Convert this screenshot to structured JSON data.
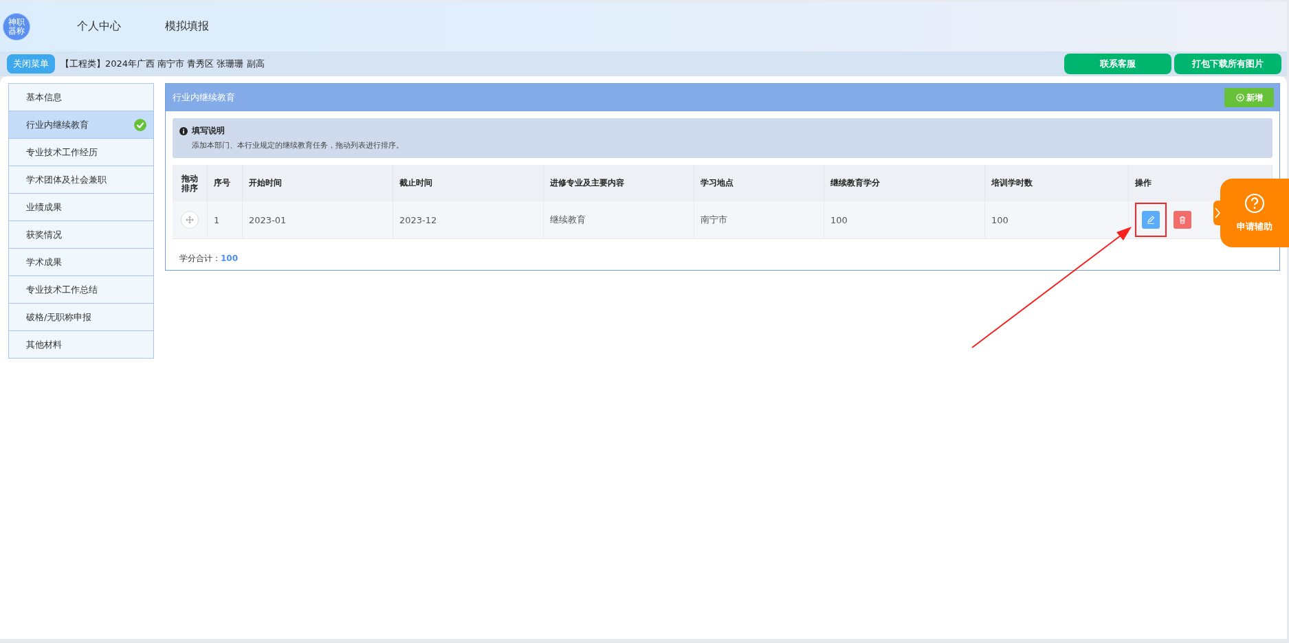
{
  "header": {
    "logo_text": "神职器称",
    "nav": [
      {
        "label": "个人中心"
      },
      {
        "label": "模拟填报"
      }
    ]
  },
  "subbar": {
    "close_menu": "关闭菜单",
    "info": "【工程类】2024年广西 南宁市 青秀区 张珊珊 副高",
    "buttons": [
      "联系客服",
      "打包下载所有图片"
    ]
  },
  "sidebar": {
    "items": [
      {
        "label": "基本信息",
        "selected": false,
        "completed": false
      },
      {
        "label": "行业内继续教育",
        "selected": true,
        "completed": true
      },
      {
        "label": "专业技术工作经历",
        "selected": false,
        "completed": false
      },
      {
        "label": "学术团体及社会兼职",
        "selected": false,
        "completed": false
      },
      {
        "label": "业绩成果",
        "selected": false,
        "completed": false
      },
      {
        "label": "获奖情况",
        "selected": false,
        "completed": false
      },
      {
        "label": "学术成果",
        "selected": false,
        "completed": false
      },
      {
        "label": "专业技术工作总结",
        "selected": false,
        "completed": false
      },
      {
        "label": "破格/无职称申报",
        "selected": false,
        "completed": false
      },
      {
        "label": "其他材料",
        "selected": false,
        "completed": false
      }
    ]
  },
  "panel": {
    "title": "行业内继续教育",
    "add_button": "新增",
    "note": {
      "title": "填写说明",
      "text": "添加本部门、本行业规定的继续教育任务，拖动列表进行排序。"
    },
    "table": {
      "columns": [
        "拖动排序",
        "序号",
        "开始时间",
        "截止时间",
        "进修专业及主要内容",
        "学习地点",
        "继续教育学分",
        "培训学时数",
        "操作"
      ],
      "rows": [
        {
          "cells": [
            "",
            "1",
            "2023-01",
            "2023-12",
            "继续教育",
            "南宁市",
            "100",
            "100"
          ],
          "edit_highlighted": true
        }
      ]
    },
    "total": {
      "label": "学分合计：",
      "value": "100"
    }
  },
  "help_float": {
    "label": "申请辅助"
  }
}
